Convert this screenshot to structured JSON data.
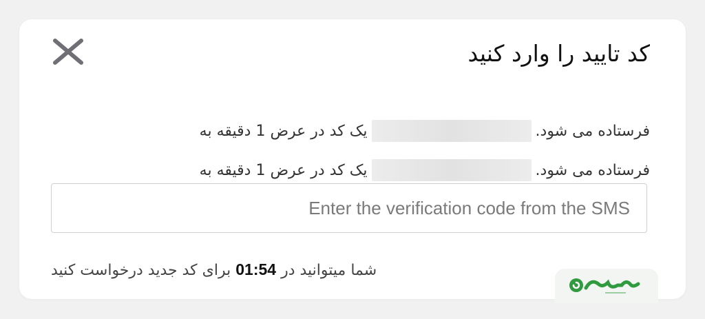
{
  "dialog": {
    "title": "کد تایید را وارد کنید",
    "line1_prefix": "یک کد در عرض 1 دقیقه به",
    "line1_suffix": "فرستاده می شود.",
    "line2_prefix": "یک کد در عرض 1 دقیقه به",
    "line2_suffix": "فرستاده می شود.",
    "input_placeholder": "Enter the verification code from the SMS",
    "countdown_before": "شما میتوانید در",
    "countdown_time": "01:54",
    "countdown_after": "برای کد جدید درخواست کنید"
  },
  "icons": {
    "close": "close-icon",
    "logo": "brand-logo"
  },
  "colors": {
    "logo_green": "#2f9a3e",
    "close_gray": "#6f6f75"
  }
}
